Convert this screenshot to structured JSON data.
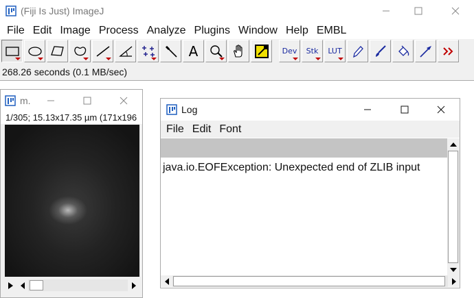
{
  "main_window": {
    "title": "(Fiji Is Just) ImageJ",
    "menu": [
      "File",
      "Edit",
      "Image",
      "Process",
      "Analyze",
      "Plugins",
      "Window",
      "Help",
      "EMBL"
    ],
    "tools": [
      {
        "name": "rectangle-tool-icon"
      },
      {
        "name": "oval-tool-icon"
      },
      {
        "name": "polygon-tool-icon"
      },
      {
        "name": "freehand-tool-icon"
      },
      {
        "name": "line-tool-icon"
      },
      {
        "name": "angle-tool-icon"
      },
      {
        "name": "multipoint-tool-icon"
      },
      {
        "name": "wand-tool-icon"
      },
      {
        "name": "text-tool-icon",
        "label": "A"
      },
      {
        "name": "magnifier-tool-icon"
      },
      {
        "name": "hand-tool-icon"
      },
      {
        "name": "color-picker-tool-icon"
      },
      {
        "name": "dev-tool-icon",
        "label": "Dev"
      },
      {
        "name": "stk-tool-icon",
        "label": "Stk"
      },
      {
        "name": "lut-tool-icon",
        "label": "LUT"
      },
      {
        "name": "pencil-tool-icon"
      },
      {
        "name": "brush-tool-icon"
      },
      {
        "name": "flood-fill-tool-icon"
      },
      {
        "name": "arrow-tool-icon"
      },
      {
        "name": "more-tools-icon"
      }
    ],
    "status": "268.26 seconds (0.1 MB/sec)"
  },
  "image_window": {
    "title": "m.",
    "info": "1/305; 15.13x17.35 µm (171x196"
  },
  "log_window": {
    "title": "Log",
    "menu": [
      "File",
      "Edit",
      "Font"
    ],
    "lines": [
      "java.io.EOFException: Unexpected end of ZLIB input"
    ]
  },
  "colors": {
    "fiji_blue": "#1f5fbf",
    "selection_yellow": "#f0e000",
    "red_triangle": "#c00000"
  }
}
